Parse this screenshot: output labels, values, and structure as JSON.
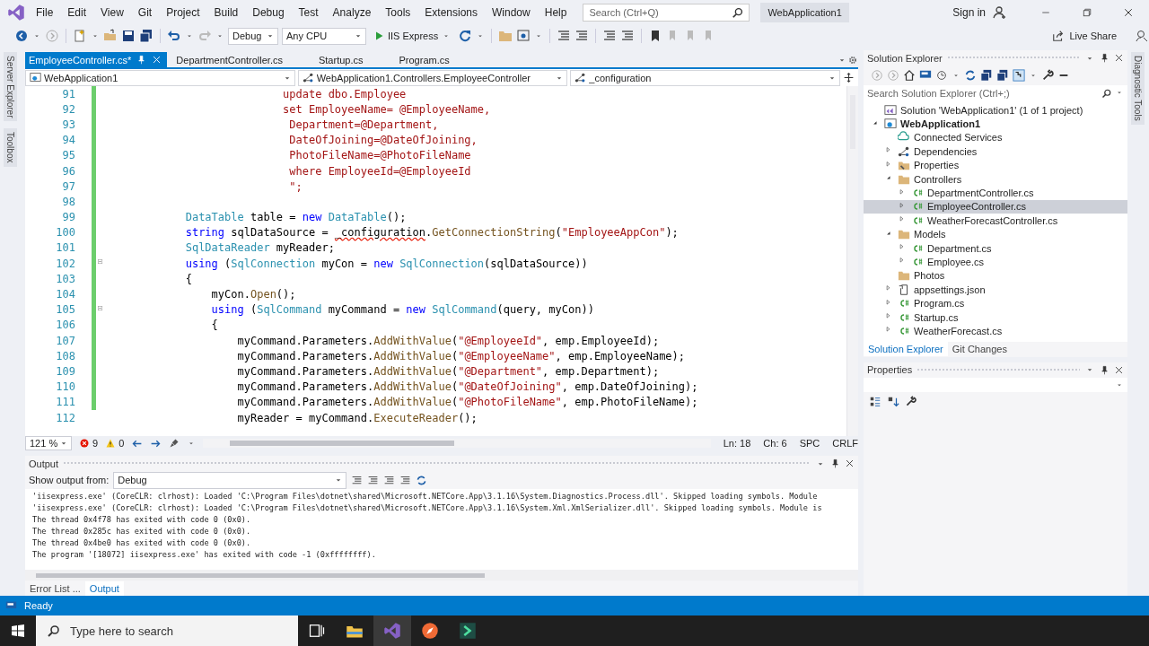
{
  "window": {
    "title": "WebApplication1"
  },
  "menu": [
    "File",
    "Edit",
    "View",
    "Git",
    "Project",
    "Build",
    "Debug",
    "Test",
    "Analyze",
    "Tools",
    "Extensions",
    "Window",
    "Help"
  ],
  "search": {
    "placeholder": "Search (Ctrl+Q)"
  },
  "account": {
    "label": "Sign in"
  },
  "toolbar": {
    "configuration": "Debug",
    "platform": "Any CPU",
    "run_target": "IIS Express",
    "live_share": "Live Share"
  },
  "side_tabs_left": [
    "Server Explorer",
    "Toolbox"
  ],
  "side_tabs_right": [
    "Diagnostic Tools"
  ],
  "editor": {
    "tabs": [
      {
        "label": "EmployeeController.cs*",
        "selected": true
      },
      {
        "label": "DepartmentController.cs",
        "selected": false
      },
      {
        "label": "Startup.cs",
        "selected": false
      },
      {
        "label": "Program.cs",
        "selected": false
      }
    ],
    "nav": {
      "project": "WebApplication1",
      "type": "WebApplication1.Controllers.EmployeeController",
      "member": "_configuration"
    },
    "lines": [
      {
        "number": "91",
        "fold": false,
        "tokens": [
          {
            "kind": "str",
            "text": "                           update dbo.Employee"
          }
        ]
      },
      {
        "number": "92",
        "fold": false,
        "tokens": [
          {
            "kind": "str",
            "text": "                           set EmployeeName= @EmployeeName,"
          }
        ]
      },
      {
        "number": "93",
        "fold": false,
        "tokens": [
          {
            "kind": "str",
            "text": "                            Department=@Department,"
          }
        ]
      },
      {
        "number": "94",
        "fold": false,
        "tokens": [
          {
            "kind": "str",
            "text": "                            DateOfJoining=@DateOfJoining,"
          }
        ]
      },
      {
        "number": "95",
        "fold": false,
        "tokens": [
          {
            "kind": "str",
            "text": "                            PhotoFileName=@PhotoFileName"
          }
        ]
      },
      {
        "number": "96",
        "fold": false,
        "tokens": [
          {
            "kind": "str",
            "text": "                            where EmployeeId=@EmployeeId"
          }
        ]
      },
      {
        "number": "97",
        "fold": false,
        "tokens": [
          {
            "kind": "str",
            "text": "                            \";"
          }
        ]
      },
      {
        "number": "98",
        "fold": false
      },
      {
        "number": "99",
        "fold": false,
        "tokens": [
          {
            "kind": "type",
            "text": "            DataTable"
          },
          {
            "kind": "plain",
            "text": " table = "
          },
          {
            "kind": "kw",
            "text": "new"
          },
          {
            "kind": "type",
            "text": " DataTable"
          },
          {
            "kind": "plain",
            "text": "();"
          }
        ]
      },
      {
        "number": "100",
        "fold": false,
        "tokens": [
          {
            "kind": "kw",
            "text": "            string"
          },
          {
            "kind": "plain",
            "text": " sqlDataSource = "
          },
          {
            "kind": "error",
            "text": "_configuration"
          },
          {
            "kind": "plain",
            "text": "."
          },
          {
            "kind": "method",
            "text": "GetConnectionString"
          },
          {
            "kind": "plain",
            "text": "("
          },
          {
            "kind": "str",
            "text": "\"EmployeeAppCon\""
          },
          {
            "kind": "plain",
            "text": ");"
          }
        ]
      },
      {
        "number": "101",
        "fold": false,
        "tokens": [
          {
            "kind": "type",
            "text": "            SqlDataReader"
          },
          {
            "kind": "plain",
            "text": " myReader;"
          }
        ]
      },
      {
        "number": "102",
        "fold": true,
        "tokens": [
          {
            "kind": "kw",
            "text": "            using"
          },
          {
            "kind": "plain",
            "text": " ("
          },
          {
            "kind": "type",
            "text": "SqlConnection"
          },
          {
            "kind": "plain",
            "text": " myCon = "
          },
          {
            "kind": "kw",
            "text": "new"
          },
          {
            "kind": "type",
            "text": " SqlConnection"
          },
          {
            "kind": "plain",
            "text": "(sqlDataSource))"
          }
        ]
      },
      {
        "number": "103",
        "fold": false,
        "tokens": [
          {
            "kind": "plain",
            "text": "            {"
          }
        ]
      },
      {
        "number": "104",
        "fold": false,
        "tokens": [
          {
            "kind": "plain",
            "text": "                myCon."
          },
          {
            "kind": "method",
            "text": "Open"
          },
          {
            "kind": "plain",
            "text": "();"
          }
        ]
      },
      {
        "number": "105",
        "fold": true,
        "tokens": [
          {
            "kind": "kw",
            "text": "                using"
          },
          {
            "kind": "plain",
            "text": " ("
          },
          {
            "kind": "type",
            "text": "SqlCommand"
          },
          {
            "kind": "plain",
            "text": " myCommand = "
          },
          {
            "kind": "kw",
            "text": "new"
          },
          {
            "kind": "type",
            "text": " SqlCommand"
          },
          {
            "kind": "plain",
            "text": "(query, myCon))"
          }
        ]
      },
      {
        "number": "106",
        "fold": false,
        "tokens": [
          {
            "kind": "plain",
            "text": "                {"
          }
        ]
      },
      {
        "number": "107",
        "fold": false,
        "tokens": [
          {
            "kind": "plain",
            "text": "                    myCommand.Parameters."
          },
          {
            "kind": "method",
            "text": "AddWithValue"
          },
          {
            "kind": "plain",
            "text": "("
          },
          {
            "kind": "str",
            "text": "\"@EmployeeId\""
          },
          {
            "kind": "plain",
            "text": ", emp.EmployeeId);"
          }
        ]
      },
      {
        "number": "108",
        "fold": false,
        "tokens": [
          {
            "kind": "plain",
            "text": "                    myCommand.Parameters."
          },
          {
            "kind": "method",
            "text": "AddWithValue"
          },
          {
            "kind": "plain",
            "text": "("
          },
          {
            "kind": "str",
            "text": "\"@EmployeeName\""
          },
          {
            "kind": "plain",
            "text": ", emp.EmployeeName);"
          }
        ]
      },
      {
        "number": "109",
        "fold": false,
        "tokens": [
          {
            "kind": "plain",
            "text": "                    myCommand.Parameters."
          },
          {
            "kind": "method",
            "text": "AddWithValue"
          },
          {
            "kind": "plain",
            "text": "("
          },
          {
            "kind": "str",
            "text": "\"@Department\""
          },
          {
            "kind": "plain",
            "text": ", emp.Department);"
          }
        ]
      },
      {
        "number": "110",
        "fold": false,
        "tokens": [
          {
            "kind": "plain",
            "text": "                    myCommand.Parameters."
          },
          {
            "kind": "method",
            "text": "AddWithValue"
          },
          {
            "kind": "plain",
            "text": "("
          },
          {
            "kind": "str",
            "text": "\"@DateOfJoining\""
          },
          {
            "kind": "plain",
            "text": ", emp.DateOfJoining);"
          }
        ]
      },
      {
        "number": "111",
        "fold": false,
        "tokens": [
          {
            "kind": "plain",
            "text": "                    myCommand.Parameters."
          },
          {
            "kind": "method",
            "text": "AddWithValue"
          },
          {
            "kind": "plain",
            "text": "("
          },
          {
            "kind": "str",
            "text": "\"@PhotoFileName\""
          },
          {
            "kind": "plain",
            "text": ", emp.PhotoFileName);"
          }
        ]
      },
      {
        "number": "112",
        "fold": false,
        "tokens": [
          {
            "kind": "plain",
            "text": "                    myReader = myCommand."
          },
          {
            "kind": "method",
            "text": "ExecuteReader"
          },
          {
            "kind": "plain",
            "text": "();"
          }
        ]
      }
    ],
    "status": {
      "zoom": "121 %",
      "errors": "9",
      "warnings": "0",
      "line": "Ln: 18",
      "column": "Ch: 6",
      "spacing": "SPC",
      "line_ending": "CRLF"
    }
  },
  "output": {
    "title": "Output",
    "source_label": "Show output from:",
    "source": "Debug",
    "lines": [
      "'iisexpress.exe' (CoreCLR: clrhost): Loaded 'C:\\Program Files\\dotnet\\shared\\Microsoft.NETCore.App\\3.1.16\\System.Diagnostics.Process.dll'. Skipped loading symbols. Module",
      "'iisexpress.exe' (CoreCLR: clrhost): Loaded 'C:\\Program Files\\dotnet\\shared\\Microsoft.NETCore.App\\3.1.16\\System.Xml.XmlSerializer.dll'. Skipped loading symbols. Module is",
      "The thread 0x4f78 has exited with code 0 (0x0).",
      "The thread 0x285c has exited with code 0 (0x0).",
      "The thread 0x4be0 has exited with code 0 (0x0).",
      "The program '[18072] iisexpress.exe' has exited with code -1 (0xffffffff)."
    ],
    "tabs": [
      {
        "label": "Error List ...",
        "selected": false
      },
      {
        "label": "Output",
        "selected": true
      }
    ]
  },
  "solution_explorer": {
    "title": "Solution Explorer",
    "search": {
      "placeholder": "Search Solution Explorer (Ctrl+;)"
    },
    "tree": [
      {
        "label": "Solution 'WebApplication1' (1 of 1 project)",
        "kind": "solution",
        "expandable": false,
        "selected": false,
        "children": [
          {
            "label": "WebApplication1",
            "kind": "project",
            "expandable": true,
            "expanded": true,
            "selected": false,
            "children": [
              {
                "label": "Connected Services",
                "kind": "service",
                "expandable": false,
                "selected": false
              },
              {
                "label": "Dependencies",
                "kind": "dependencies",
                "expandable": true,
                "expanded": false,
                "selected": false
              },
              {
                "label": "Properties",
                "kind": "properties",
                "expandable": true,
                "expanded": false,
                "selected": false
              },
              {
                "label": "Controllers",
                "kind": "folder",
                "expandable": true,
                "expanded": true,
                "selected": false,
                "children": [
                  {
                    "label": "DepartmentController.cs",
                    "kind": "code",
                    "expandable": true,
                    "expanded": false,
                    "selected": false
                  },
                  {
                    "label": "EmployeeController.cs",
                    "kind": "code",
                    "expandable": true,
                    "expanded": false,
                    "selected": true
                  },
                  {
                    "label": "WeatherForecastController.cs",
                    "kind": "code",
                    "expandable": true,
                    "expanded": false,
                    "selected": false
                  }
                ]
              },
              {
                "label": "Models",
                "kind": "folder",
                "expandable": true,
                "expanded": true,
                "selected": false,
                "children": [
                  {
                    "label": "Department.cs",
                    "kind": "code",
                    "expandable": true,
                    "expanded": false,
                    "selected": false
                  },
                  {
                    "label": "Employee.cs",
                    "kind": "code",
                    "expandable": true,
                    "expanded": false,
                    "selected": false
                  }
                ]
              },
              {
                "label": "Photos",
                "kind": "folder",
                "expandable": false,
                "selected": false
              },
              {
                "label": "appsettings.json",
                "kind": "json",
                "expandable": true,
                "expanded": false,
                "selected": false
              },
              {
                "label": "Program.cs",
                "kind": "code",
                "expandable": true,
                "expanded": false,
                "selected": false
              },
              {
                "label": "Startup.cs",
                "kind": "code",
                "expandable": true,
                "expanded": false,
                "selected": false
              },
              {
                "label": "WeatherForecast.cs",
                "kind": "code",
                "expandable": true,
                "expanded": false,
                "selected": false
              }
            ]
          }
        ]
      }
    ],
    "tabs": [
      {
        "label": "Solution Explorer",
        "selected": true
      },
      {
        "label": "Git Changes",
        "selected": false
      }
    ]
  },
  "properties": {
    "title": "Properties"
  },
  "status_bar": {
    "text": "Ready"
  },
  "taskbar": {
    "search": {
      "placeholder": "Type here to search"
    }
  }
}
